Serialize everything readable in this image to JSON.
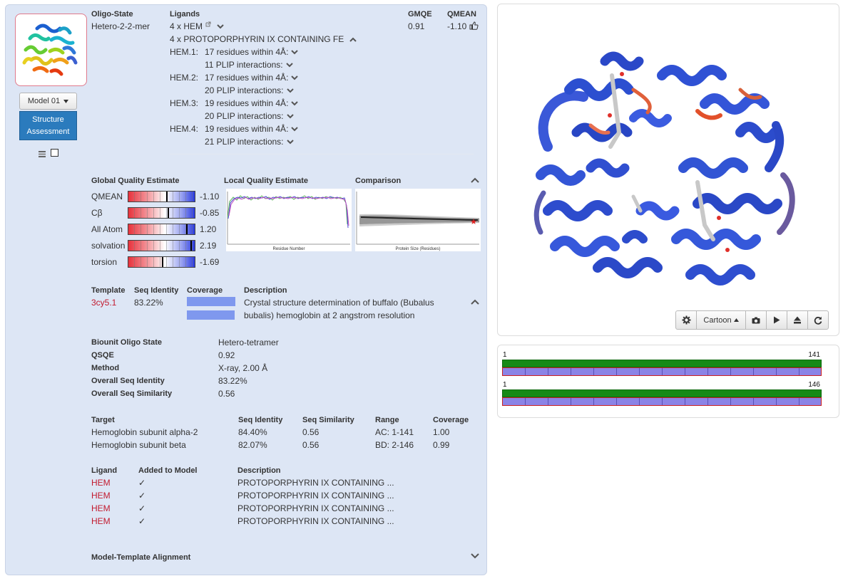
{
  "summary": {
    "oligo_state_label": "Oligo-State",
    "oligo_state_value": "Hetero-2-2-mer",
    "ligands_label": "Ligands",
    "ligand_line1": "4 x HEM",
    "ligand_line2": "4 x PROTOPORPHYRIN IX CONTAINING FE",
    "gmqe_label": "GMQE",
    "gmqe_value": "0.91",
    "qmean_label": "QMEAN",
    "qmean_value": "-1.10",
    "hem_items": [
      {
        "name": "HEM.1:",
        "residues": "17 residues within 4Å:",
        "plip": "11 PLIP interactions:"
      },
      {
        "name": "HEM.2:",
        "residues": "17 residues within 4Å:",
        "plip": "20 PLIP interactions:"
      },
      {
        "name": "HEM.3:",
        "residues": "19 residues within 4Å:",
        "plip": "20 PLIP interactions:"
      },
      {
        "name": "HEM.4:",
        "residues": "19 residues within 4Å:",
        "plip": "21 PLIP interactions:"
      }
    ]
  },
  "model": {
    "model_button": "Model 01",
    "assessment_line1": "Structure",
    "assessment_line2": "Assessment"
  },
  "quality": {
    "global_title": "Global Quality Estimate",
    "local_title": "Local Quality Estimate",
    "comparison_title": "Comparison",
    "local_xlabel": "Residue Number",
    "comparison_xlabel": "Protein Size (Residues)",
    "rows": [
      {
        "label": "QMEAN",
        "value": "-1.10",
        "marker": 0.58
      },
      {
        "label": "Cβ",
        "value": "-0.85",
        "marker": 0.6
      },
      {
        "label": "All Atom",
        "value": "1.20",
        "marker": 0.88
      },
      {
        "label": "solvation",
        "value": "2.19",
        "marker": 0.95
      },
      {
        "label": "torsion",
        "value": "-1.69",
        "marker": 0.52
      }
    ]
  },
  "template": {
    "headers": [
      "Template",
      "Seq Identity",
      "Coverage",
      "Description"
    ],
    "id": "3cy5.1",
    "seq_identity": "83.22%",
    "description_line1": "Crystal structure determination of buffalo (Bubalus",
    "description_line2": "bubalis) hemoglobin at 2 angstrom resolution",
    "coverage": [
      1.0,
      0.99
    ]
  },
  "biounit": {
    "rows": [
      {
        "label": "Biounit Oligo State",
        "value": "Hetero-tetramer"
      },
      {
        "label": "QSQE",
        "value": "0.92"
      },
      {
        "label": "Method",
        "value": "X-ray, 2.00 Å"
      },
      {
        "label": "Overall Seq Identity",
        "value": "83.22%"
      },
      {
        "label": "Overall Seq Similarity",
        "value": "0.56"
      }
    ]
  },
  "targets": {
    "headers": [
      "Target",
      "Seq Identity",
      "Seq Similarity",
      "Range",
      "Coverage"
    ],
    "rows": [
      {
        "target": "Hemoglobin subunit alpha-2",
        "identity": "84.40%",
        "similarity": "0.56",
        "range": "AC: 1-141",
        "coverage": "1.00"
      },
      {
        "target": "Hemoglobin subunit beta",
        "identity": "82.07%",
        "similarity": "0.56",
        "range": "BD: 2-146",
        "coverage": "0.99"
      }
    ]
  },
  "ligands": {
    "headers": [
      "Ligand",
      "Added to Model",
      "Description"
    ],
    "rows": [
      {
        "ligand": "HEM",
        "added": "✓",
        "description": "PROTOPORPHYRIN IX CONTAINING ..."
      },
      {
        "ligand": "HEM",
        "added": "✓",
        "description": "PROTOPORPHYRIN IX CONTAINING ..."
      },
      {
        "ligand": "HEM",
        "added": "✓",
        "description": "PROTOPORPHYRIN IX CONTAINING ..."
      },
      {
        "ligand": "HEM",
        "added": "✓",
        "description": "PROTOPORPHYRIN IX CONTAINING ..."
      }
    ]
  },
  "alignment": {
    "title": "Model-Template Alignment"
  },
  "viewer": {
    "toolbar": {
      "style_label": "Cartoon"
    },
    "icons": [
      "gear-icon",
      "camera-icon",
      "play-icon",
      "eject-icon",
      "refresh-icon"
    ]
  },
  "sequences": [
    {
      "start": "1",
      "end": "141"
    },
    {
      "start": "1",
      "end": "146"
    }
  ],
  "colors": {
    "panel_bg": "#dde6f5",
    "link_red": "#c21a2e",
    "button_blue": "#2b7bbd",
    "seq_green": "#168a16",
    "seq_blue": "#8b83e6",
    "coverage_blue": "#7f98ee"
  }
}
